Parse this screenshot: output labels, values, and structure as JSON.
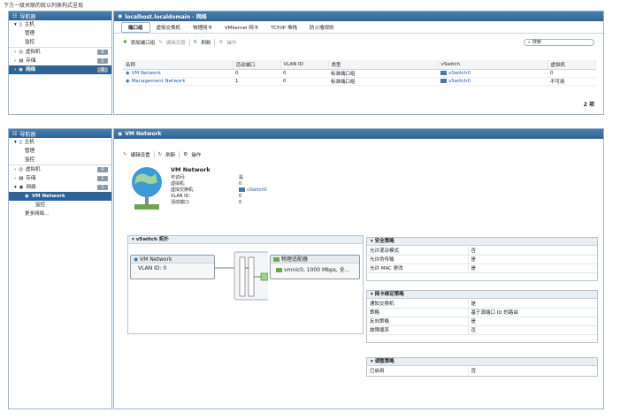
{
  "top_caption": "下方一级关联的就以列表构式呈现",
  "nav": {
    "title": "导航器",
    "items": [
      {
        "label": "主机",
        "kind": "host"
      },
      {
        "label": "管理",
        "kind": "sub"
      },
      {
        "label": "监控",
        "kind": "sub"
      },
      {
        "label": "虚拟机",
        "badge": "0"
      },
      {
        "label": "存储",
        "badge": "1"
      },
      {
        "label": "网络",
        "badge": "1"
      }
    ],
    "items2": [
      {
        "label": "主机"
      },
      {
        "label": "管理"
      },
      {
        "label": "监控"
      },
      {
        "label": "虚拟机",
        "badge": "0"
      },
      {
        "label": "存储",
        "badge": "1"
      },
      {
        "label": "网络",
        "badge": "1"
      },
      {
        "label": "VM Network"
      },
      {
        "label": "监控"
      },
      {
        "label": "更多网络..."
      }
    ]
  },
  "top_panel": {
    "title": "localhost.localdomain - 网络",
    "tabs": [
      "端口组",
      "虚拟交换机",
      "物理网卡",
      "VMkernel 网卡",
      "TCP/IP 堆栈",
      "防火墙规则"
    ],
    "toolbar": {
      "add": "添加端口组",
      "edit": "编辑设置",
      "refresh": "刷新",
      "actions": "操作",
      "search_placeholder": "搜索"
    },
    "columns": [
      "名称",
      "活动端口",
      "VLAN ID",
      "类型",
      "vSwitch",
      "虚拟机"
    ],
    "rows": [
      {
        "name": "VM Network",
        "ports": "0",
        "vlan": "0",
        "type": "标准端口组",
        "vswitch": "vSwitch0",
        "vms": "0"
      },
      {
        "name": "Management Network",
        "ports": "1",
        "vlan": "0",
        "type": "标准端口组",
        "vswitch": "vSwitch0",
        "vms": "不可用"
      }
    ],
    "count": "2 项"
  },
  "bottom_panel": {
    "title": "VM Network",
    "toolbar": {
      "edit": "编辑设置",
      "refresh": "刷新",
      "actions": "操作"
    },
    "summary": {
      "name": "VM Network",
      "fields": [
        {
          "k": "可访问:",
          "v": "是"
        },
        {
          "k": "虚拟机:",
          "v": "0"
        },
        {
          "k": "虚拟交换机:",
          "v": "vSwitch0"
        },
        {
          "k": "VLAN ID:",
          "v": "0"
        },
        {
          "k": "活动端口:",
          "v": "0"
        }
      ]
    },
    "topology": {
      "title": "vSwitch 拓扑",
      "portgroup": "VM Network",
      "vlan": "VLAN ID: 0",
      "uplinks": "物理适配器",
      "nic": "vmnic0, 1000 Mbps, 全..."
    },
    "security": {
      "title": "安全策略",
      "rows": [
        [
          "允许混杂模式",
          "否"
        ],
        [
          "允许伪传输",
          "是"
        ],
        [
          "允许 MAC 更改",
          "是"
        ]
      ]
    },
    "teaming": {
      "title": "网卡绑定策略",
      "rows": [
        [
          "通知交换机",
          "是"
        ],
        [
          "策略",
          "基于源端口 ID 的路由"
        ],
        [
          "反向策略",
          "是"
        ],
        [
          "故障顺序",
          "否"
        ]
      ]
    },
    "shaping": {
      "title": "调整策略",
      "rows": [
        [
          "已启用",
          "否"
        ]
      ]
    }
  }
}
